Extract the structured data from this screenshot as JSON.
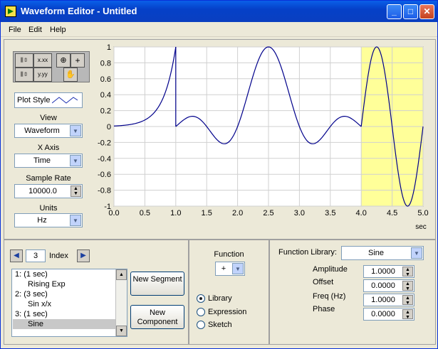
{
  "window": {
    "title": "Waveform Editor - Untitled",
    "minimize": "_",
    "maximize": "□",
    "close": "✕"
  },
  "menu": [
    "File",
    "Edit",
    "Help"
  ],
  "left_panel": {
    "plot_style_label": "Plot Style",
    "view_label": "View",
    "view_value": "Waveform",
    "x_axis_label": "X Axis",
    "x_axis_value": "Time",
    "sample_rate_label": "Sample Rate",
    "sample_rate_value": "10000.0",
    "units_label": "Units",
    "units_value": "Hz"
  },
  "chart_data": {
    "type": "line",
    "xlabel": "sec",
    "xlim": [
      0.0,
      5.0
    ],
    "ylim": [
      -1,
      1
    ],
    "x_ticks": [
      "0.0",
      "0.5",
      "1.0",
      "1.5",
      "2.0",
      "2.5",
      "3.0",
      "3.5",
      "4.0",
      "4.5",
      "5.0"
    ],
    "y_ticks": [
      "1",
      "0.8",
      "0.6",
      "0.4",
      "0.2",
      "0",
      "-0.2",
      "-0.4",
      "-0.6",
      "-0.8",
      "-1"
    ],
    "grid": true,
    "highlight_region": [
      4.0,
      5.0
    ],
    "highlight_color": "#ffff99",
    "line_color": "#00008b",
    "segments": [
      {
        "name": "Rising Exp",
        "x_start": 0.0,
        "x_end": 1.0
      },
      {
        "name": "Sin x/x",
        "x_start": 1.0,
        "x_end": 4.0
      },
      {
        "name": "Sine",
        "x_start": 4.0,
        "x_end": 5.0
      }
    ]
  },
  "segments_panel": {
    "index_value": "3",
    "index_label": "Index",
    "list": [
      {
        "head": "1:  (1 sec)",
        "name": "Rising Exp"
      },
      {
        "head": "2:  (3 sec)",
        "name": "Sin x/x"
      },
      {
        "head": "3:  (1 sec)",
        "name": "Sine"
      }
    ],
    "new_segment": "New Segment",
    "new_component": "New Component"
  },
  "function_panel": {
    "label": "Function",
    "value": "+",
    "options": [
      "Library",
      "Expression",
      "Sketch"
    ],
    "selected": "Library"
  },
  "library_panel": {
    "label": "Function Library:",
    "value": "Sine",
    "amplitude_label": "Amplitude",
    "amplitude": "1.0000",
    "offset_label": "Offset",
    "offset": "0.0000",
    "freq_label": "Freq (Hz)",
    "freq": "1.0000",
    "phase_label": "Phase",
    "phase": "0.0000"
  }
}
